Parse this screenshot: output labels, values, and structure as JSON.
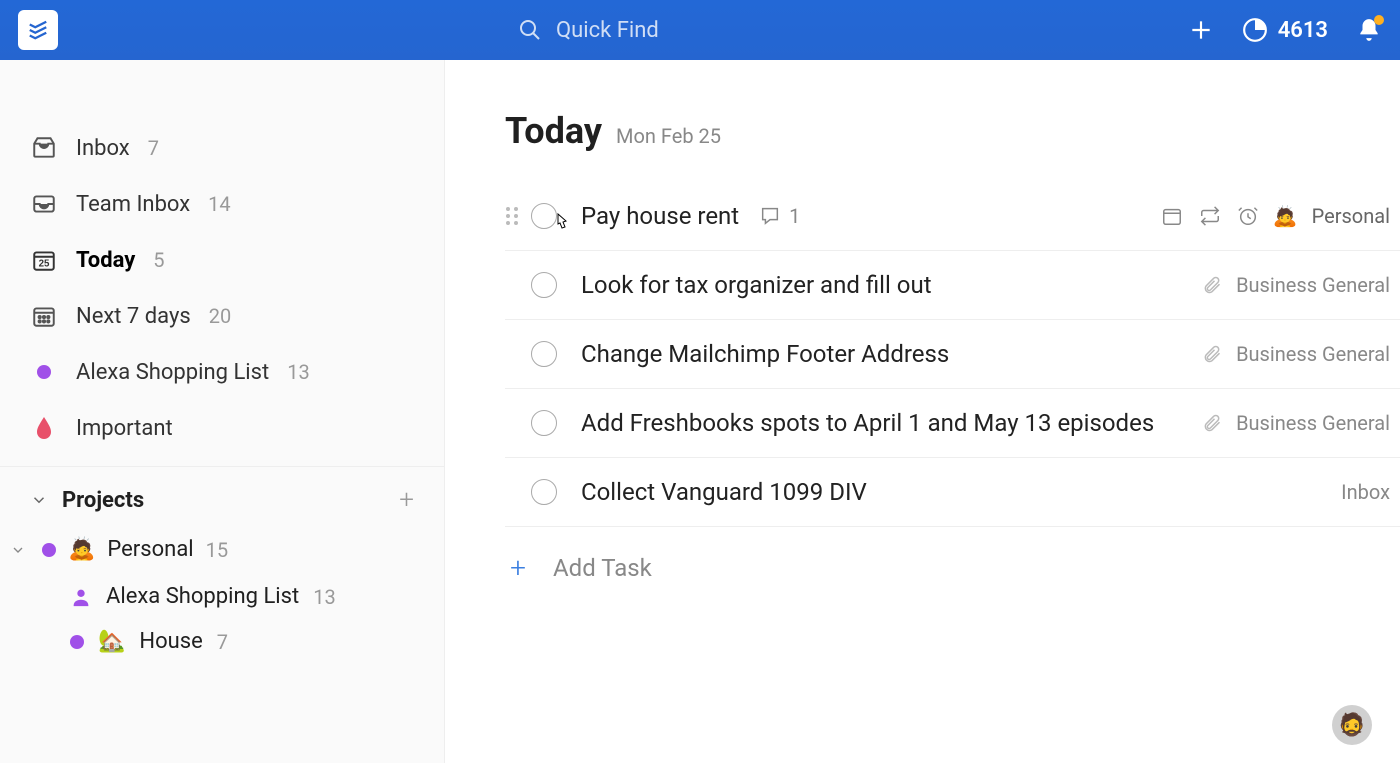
{
  "header": {
    "search_placeholder": "Quick Find",
    "karma_points": "4613"
  },
  "sidebar": {
    "inbox": {
      "label": "Inbox",
      "count": "7"
    },
    "team_inbox": {
      "label": "Team Inbox",
      "count": "14"
    },
    "today": {
      "label": "Today",
      "count": "5"
    },
    "next7": {
      "label": "Next 7 days",
      "count": "20"
    },
    "alexa": {
      "label": "Alexa Shopping List",
      "count": "13"
    },
    "important": {
      "label": "Important"
    },
    "projects_label": "Projects",
    "projects": {
      "personal": {
        "label": "Personal",
        "count": "15",
        "emoji": "🙇"
      },
      "alexa": {
        "label": "Alexa Shopping List",
        "count": "13"
      },
      "house": {
        "label": "House",
        "count": "7",
        "emoji": "🏡"
      }
    }
  },
  "main": {
    "title": "Today",
    "date": "Mon Feb 25",
    "add_task_label": "Add Task",
    "tasks": [
      {
        "title": "Pay house rent",
        "comments": "1",
        "project": "Personal",
        "project_emoji": "🙇",
        "hovered": true
      },
      {
        "title": "Look for tax organizer and fill out",
        "project": "Business General",
        "attach": true
      },
      {
        "title": "Change Mailchimp Footer Address",
        "project": "Business General",
        "attach": true
      },
      {
        "title": "Add Freshbooks spots to April 1 and May 13 episodes",
        "project": "Business General",
        "attach": true
      },
      {
        "title": "Collect Vanguard 1099 DIV",
        "project": "Inbox"
      }
    ]
  }
}
